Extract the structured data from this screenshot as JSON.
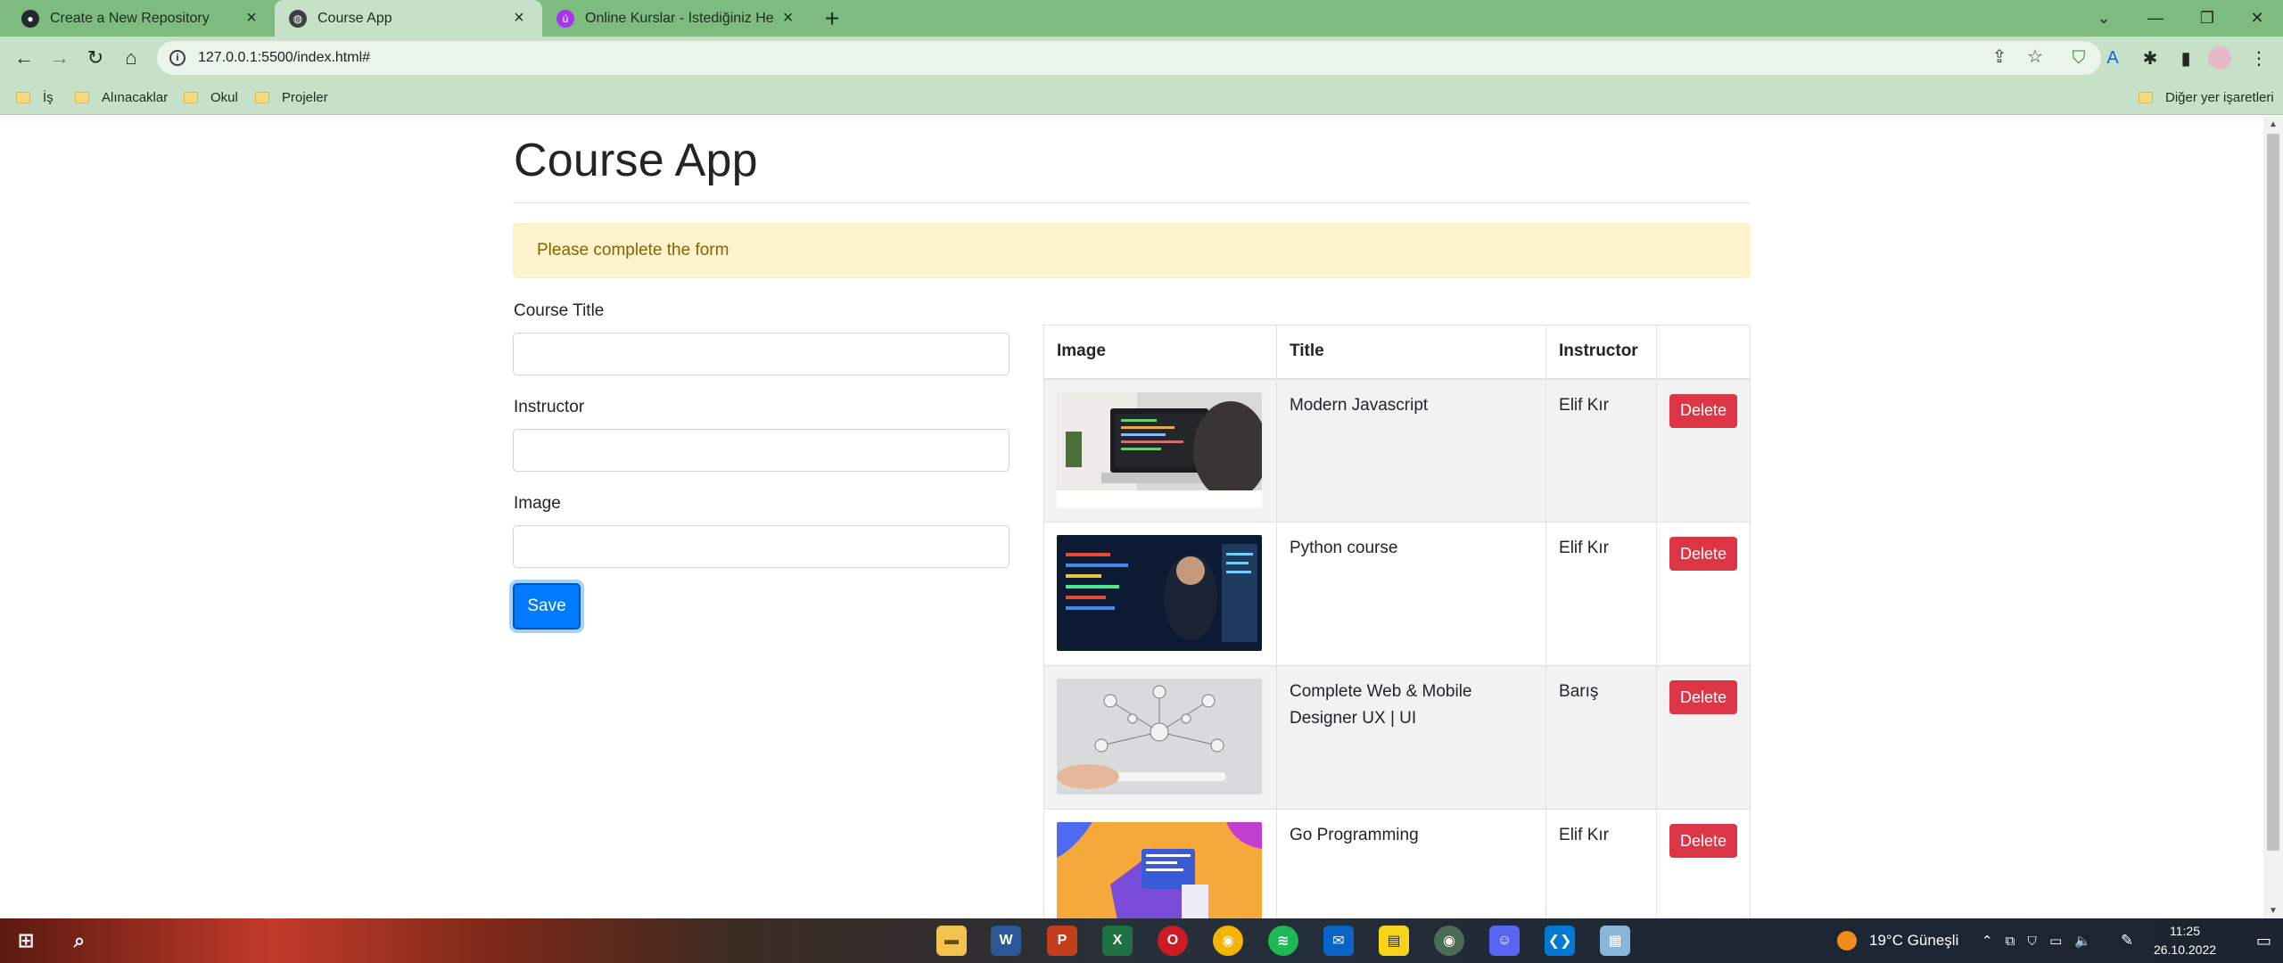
{
  "browser": {
    "tabs": [
      {
        "title": "Create a New Repository",
        "icon": "github-icon"
      },
      {
        "title": "Course App",
        "icon": "globe-icon"
      },
      {
        "title": "Online Kurslar - İstediğiniz Her Şeyi",
        "icon": "udemy-icon"
      }
    ],
    "url": "127.0.0.1:5500/index.html#",
    "bookmarks": [
      "İş",
      "Alınacaklar",
      "Okul",
      "Projeler"
    ],
    "other_bookmarks": "Diğer yer işaretleri"
  },
  "page": {
    "title": "Course App",
    "alert": "Please complete the form",
    "form": {
      "title_label": "Course Title",
      "instructor_label": "Instructor",
      "image_label": "Image",
      "title_value": "",
      "instructor_value": "",
      "image_value": "",
      "save_label": "Save"
    },
    "table": {
      "headers": [
        "Image",
        "Title",
        "Instructor",
        ""
      ],
      "rows": [
        {
          "title": "Modern Javascript",
          "instructor": "Elif Kır",
          "delete": "Delete"
        },
        {
          "title": "Python course",
          "instructor": "Elif Kır",
          "delete": "Delete"
        },
        {
          "title": "Complete Web & Mobile Designer UX | UI",
          "instructor": "Barış",
          "delete": "Delete"
        },
        {
          "title": "Go Programming",
          "instructor": "Elif Kır",
          "delete": "Delete"
        }
      ]
    }
  },
  "taskbar": {
    "weather": "19°C  Güneşli",
    "time": "11:25",
    "date": "26.10.2022"
  },
  "colors": {
    "accent": "#007bff",
    "danger": "#dc3545",
    "alert_bg": "#fff3cd",
    "chrome_frame": "#7dbb7f"
  }
}
